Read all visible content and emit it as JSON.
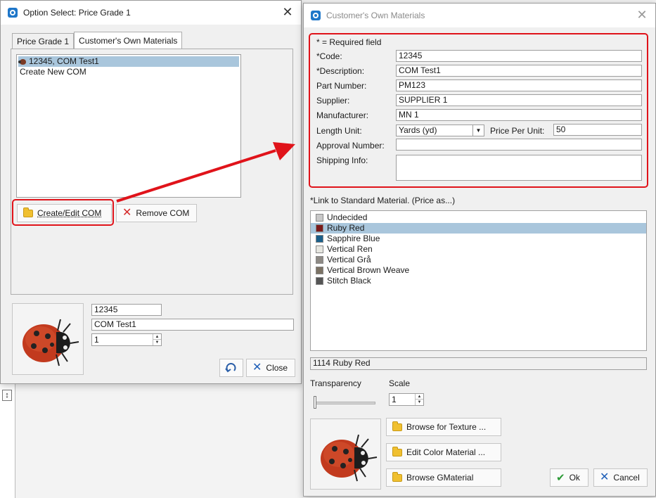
{
  "left_window": {
    "title": "Option Select: Price Grade 1",
    "tabs": [
      {
        "label": "Price Grade 1",
        "active": false
      },
      {
        "label": "Customer's Own Materials",
        "active": true
      }
    ],
    "com_list": [
      {
        "label": "12345, COM Test1",
        "selected": true,
        "icon": "ladybug-icon"
      },
      {
        "label": "Create New COM",
        "selected": false
      }
    ],
    "create_edit_label": "Create/Edit COM",
    "remove_label": "Remove COM",
    "code_value": "12345",
    "name_value": "COM Test1",
    "quantity_value": "1",
    "close_label": "Close"
  },
  "right_window": {
    "title": "Customer's Own Materials",
    "required_note": "* = Required field",
    "labels": {
      "code": "*Code:",
      "description": "*Description:",
      "part_number": "Part Number:",
      "supplier": "Supplier:",
      "manufacturer": "Manufacturer:",
      "length_unit": "Length Unit:",
      "price_per_unit": "Price Per Unit:",
      "approval_number": "Approval Number:",
      "shipping_info": "Shipping Info:"
    },
    "values": {
      "code": "12345",
      "description": "COM Test1",
      "part_number": "PM123",
      "supplier": "SUPPLIER 1",
      "manufacturer": "MN 1",
      "length_unit": "Yards (yd)",
      "price_per_unit": "50",
      "approval_number": "",
      "shipping_info": ""
    },
    "link_label": "*Link to Standard Material. (Price as...)",
    "materials": [
      {
        "name": "Undecided",
        "color": "#c8c8c8",
        "selected": false
      },
      {
        "name": "Ruby Red",
        "color": "#7a1a1a",
        "selected": true
      },
      {
        "name": "Sapphire Blue",
        "color": "#1a5f8a",
        "selected": false
      },
      {
        "name": "Vertical Ren",
        "color": "#e6e6e0",
        "selected": false
      },
      {
        "name": "Vertical Grå",
        "color": "#8e8a85",
        "selected": false
      },
      {
        "name": "Vertical Brown Weave",
        "color": "#7b7264",
        "selected": false
      },
      {
        "name": "Stitch Black",
        "color": "#555555",
        "selected": false
      }
    ],
    "selected_material_status": "1114  Ruby Red",
    "transparency_label": "Transparency",
    "transparency_level": 0,
    "scale_label": "Scale",
    "scale_value": "1",
    "browse_texture_label": "Browse for Texture ...",
    "edit_color_label": "Edit Color Material ...",
    "browse_gmaterial_label": "Browse GMaterial",
    "ok_label": "Ok",
    "cancel_label": "Cancel"
  },
  "colors": {
    "highlight_red": "#e0131a",
    "selection_blue": "#a9c6dc"
  }
}
